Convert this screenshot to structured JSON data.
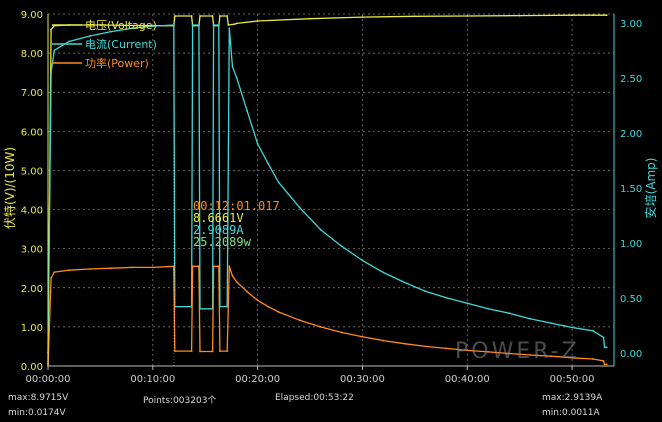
{
  "chart_data": {
    "type": "line",
    "title": "",
    "xlabel": "",
    "ylabel_left": "伏特(V)/(10W)",
    "ylabel_right": "安培(Amp)",
    "xlim_minutes": [
      0,
      54
    ],
    "ylim_left": [
      0,
      9
    ],
    "ylim_right": [
      -0.12,
      3.08
    ],
    "x_ticks": [
      "00:00:00",
      "00:10:00",
      "00:20:00",
      "00:30:00",
      "00:40:00",
      "00:50:00"
    ],
    "y_ticks_left": [
      "0.00",
      "1.00",
      "2.00",
      "3.00",
      "4.00",
      "5.00",
      "6.00",
      "7.00",
      "8.00",
      "9.00"
    ],
    "y_ticks_right": [
      "0.00",
      "0.50",
      "1.00",
      "1.50",
      "2.00",
      "2.50",
      "3.00"
    ],
    "grid": true,
    "legend_position": "top-left",
    "series": [
      {
        "name": "电压(Voltage)",
        "axis": "left",
        "color": "#e8e84a",
        "x": [
          0,
          0.3,
          0.6,
          2,
          5,
          10,
          12.0,
          12.1,
          13.7,
          13.8,
          14.4,
          14.5,
          15.7,
          15.8,
          16.3,
          16.4,
          17.1,
          17.2,
          17.8,
          18,
          20,
          25,
          30,
          35,
          40,
          45,
          50,
          52,
          53.3
        ],
        "y": [
          0.05,
          8.6,
          8.7,
          8.72,
          8.72,
          8.7,
          8.7,
          8.95,
          8.95,
          8.7,
          8.7,
          8.95,
          8.95,
          8.7,
          8.7,
          8.95,
          8.95,
          8.72,
          8.74,
          8.76,
          8.82,
          8.88,
          8.92,
          8.94,
          8.95,
          8.96,
          8.97,
          8.97,
          8.97
        ]
      },
      {
        "name": "电流(Current)",
        "axis": "right",
        "color": "#3fd8d8",
        "x": [
          0,
          0.3,
          0.6,
          2,
          4,
          6,
          8,
          10,
          12.0,
          12.1,
          13.7,
          13.8,
          14.4,
          14.5,
          15.7,
          15.8,
          16.3,
          16.4,
          17.1,
          17.3,
          17.6,
          18,
          19,
          20,
          21,
          22,
          24,
          26,
          28,
          30,
          32,
          34,
          36,
          38,
          40,
          42,
          44,
          46,
          48,
          50,
          52,
          53.0,
          53.1,
          53.3
        ],
        "y": [
          0.001,
          2.55,
          2.75,
          2.83,
          2.88,
          2.92,
          2.95,
          2.97,
          2.98,
          0.42,
          0.42,
          2.98,
          2.98,
          0.4,
          0.4,
          2.98,
          2.98,
          0.42,
          0.42,
          2.95,
          2.6,
          2.5,
          2.2,
          1.9,
          1.72,
          1.55,
          1.32,
          1.12,
          0.97,
          0.84,
          0.73,
          0.64,
          0.56,
          0.5,
          0.45,
          0.4,
          0.36,
          0.31,
          0.27,
          0.23,
          0.2,
          0.14,
          0.05,
          0.05
        ]
      },
      {
        "name": "功率(Power)",
        "axis": "left",
        "color": "#ff8a1e",
        "x": [
          0,
          0.3,
          0.6,
          2,
          4,
          6,
          8,
          10,
          12.0,
          12.1,
          13.7,
          13.8,
          14.4,
          14.5,
          15.7,
          15.8,
          16.3,
          16.4,
          17.1,
          17.3,
          17.6,
          18,
          19,
          20,
          21,
          22,
          24,
          26,
          28,
          30,
          32,
          34,
          36,
          38,
          40,
          42,
          44,
          46,
          48,
          50,
          52,
          53.0,
          53.1,
          53.3
        ],
        "y": [
          0.0,
          2.25,
          2.4,
          2.45,
          2.48,
          2.5,
          2.52,
          2.52,
          2.55,
          0.38,
          0.38,
          2.55,
          2.55,
          0.37,
          0.37,
          2.55,
          2.55,
          0.38,
          0.38,
          2.55,
          2.3,
          2.15,
          1.9,
          1.68,
          1.52,
          1.38,
          1.17,
          1.0,
          0.86,
          0.75,
          0.65,
          0.57,
          0.5,
          0.45,
          0.4,
          0.36,
          0.32,
          0.28,
          0.25,
          0.21,
          0.18,
          0.13,
          0.04,
          0.04
        ]
      }
    ],
    "annotation": {
      "x": 12.02,
      "time": "00:12:01.017",
      "voltage": "8.6661V",
      "current": "2.9089A",
      "power": "25.2089w"
    },
    "watermark": "POWER-Z"
  },
  "footer": {
    "max_voltage": "max:8.9715V",
    "min_voltage": "min:0.0174V",
    "points": "Points:003203个",
    "elapsed": "Elapsed:00:53:22",
    "max_current": "max:2.9139A",
    "min_current": "min:0.0011A"
  }
}
